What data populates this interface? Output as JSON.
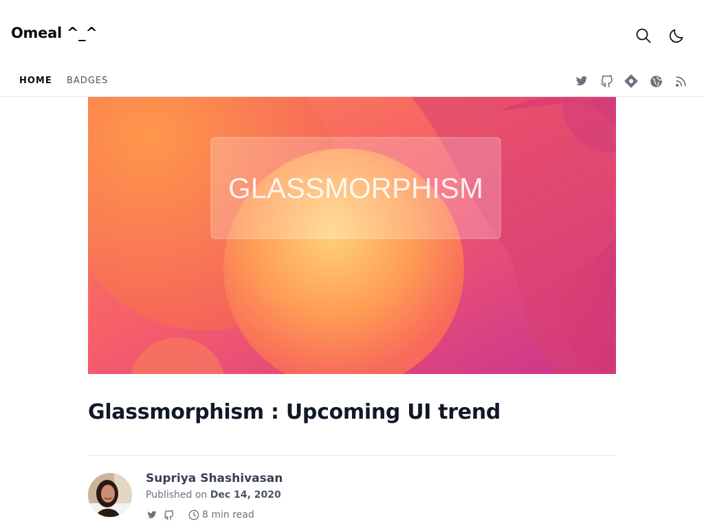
{
  "site": {
    "brand": "Omeal ^_^"
  },
  "header": {
    "search_icon": "search-icon",
    "theme_icon": "moon-icon"
  },
  "nav": {
    "items": [
      {
        "label": "HOME"
      },
      {
        "label": "BADGES"
      }
    ],
    "social_icons": [
      "twitter-icon",
      "github-icon",
      "hashnode-icon",
      "globe-icon",
      "rss-icon"
    ]
  },
  "hero": {
    "text": "GLASSMORPHISM"
  },
  "article": {
    "title": "Glassmorphism : Upcoming UI trend",
    "author": "Supriya Shashivasan",
    "published_prefix": "Published on ",
    "published_date": "Dec 14, 2020",
    "read_time": "8 min read"
  },
  "colors": {
    "text": "#111827",
    "muted": "#6b7280",
    "divider": "#e5e7eb",
    "icon": "#6b7280"
  }
}
